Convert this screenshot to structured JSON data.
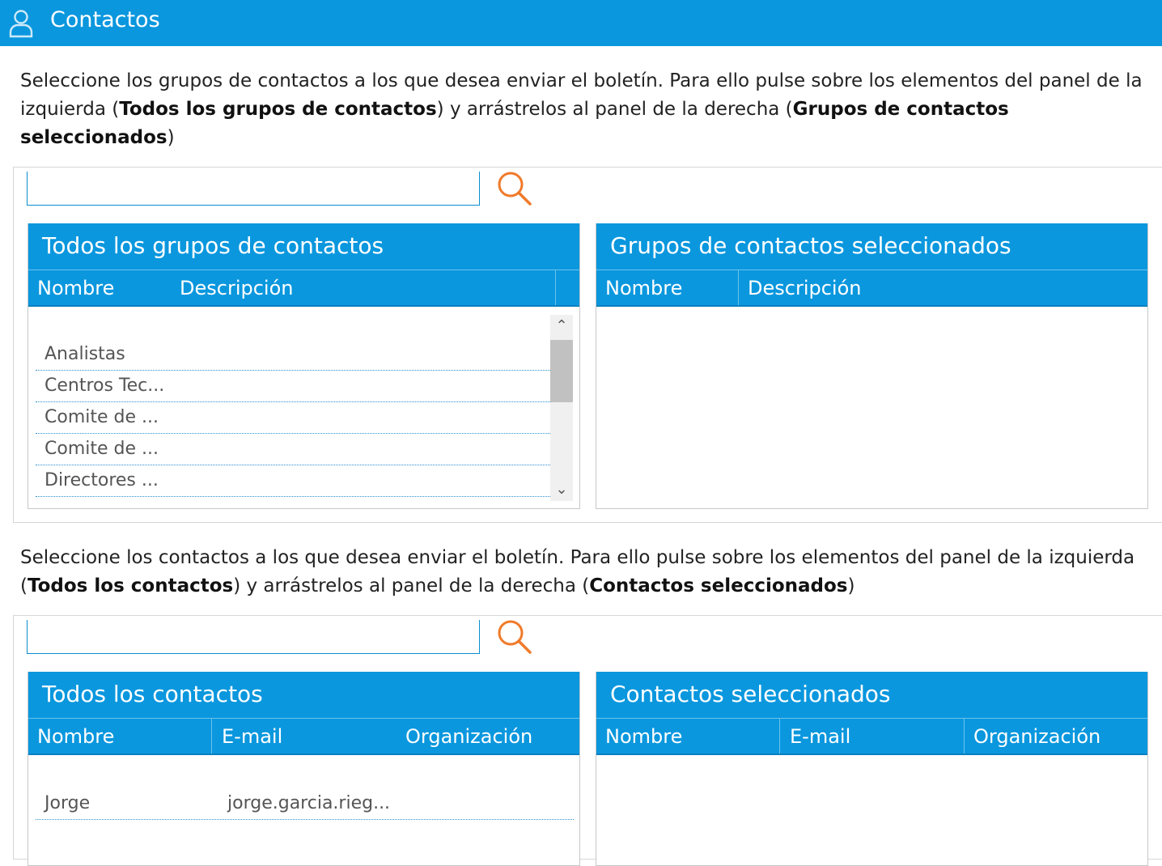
{
  "header": {
    "title": "Contactos",
    "icon": "user-icon"
  },
  "groups_section": {
    "intro_parts": [
      {
        "t": "Seleccione los grupos de contactos a los que desea enviar el boletín. Para ello pulse sobre los elementos del panel de la izquierda (",
        "b": false
      },
      {
        "t": "Todos los grupos de contactos",
        "b": true
      },
      {
        "t": ") y arrástrelos al panel de la derecha (",
        "b": false
      },
      {
        "t": "Grupos de contactos seleccionados",
        "b": true
      },
      {
        "t": ")",
        "b": false
      }
    ],
    "search": {
      "value": "",
      "placeholder": ""
    },
    "left_panel": {
      "title": "Todos los grupos de contactos",
      "columns": [
        "Nombre",
        "Descripción"
      ],
      "rows": [
        {
          "name": "Analistas",
          "description": ""
        },
        {
          "name": "Centros Tec...",
          "description": ""
        },
        {
          "name": "Comite de ...",
          "description": ""
        },
        {
          "name": "Comite de ...",
          "description": ""
        },
        {
          "name": "Directores ...",
          "description": ""
        }
      ]
    },
    "right_panel": {
      "title": "Grupos de contactos seleccionados",
      "columns": [
        "Nombre",
        "Descripción"
      ],
      "rows": []
    }
  },
  "contacts_section": {
    "intro_parts": [
      {
        "t": "Seleccione los contactos a los que desea enviar el boletín. Para ello pulse sobre los elementos del panel de la izquierda (",
        "b": false
      },
      {
        "t": "Todos los contactos",
        "b": true
      },
      {
        "t": ") y arrástrelos al panel de la derecha (",
        "b": false
      },
      {
        "t": "Contactos seleccionados",
        "b": true
      },
      {
        "t": ")",
        "b": false
      }
    ],
    "search": {
      "value": "",
      "placeholder": ""
    },
    "left_panel": {
      "title": "Todos los contactos",
      "columns": [
        "Nombre",
        "E-mail",
        "Organización"
      ],
      "rows": [
        {
          "name": "Jorge",
          "email": "jorge.garcia.rieg...",
          "organization": ""
        }
      ]
    },
    "right_panel": {
      "title": "Contactos seleccionados",
      "columns": [
        "Nombre",
        "E-mail",
        "Organización"
      ],
      "rows": []
    }
  },
  "colors": {
    "primary": "#0a97de",
    "search_icon": "#f07a2a"
  }
}
